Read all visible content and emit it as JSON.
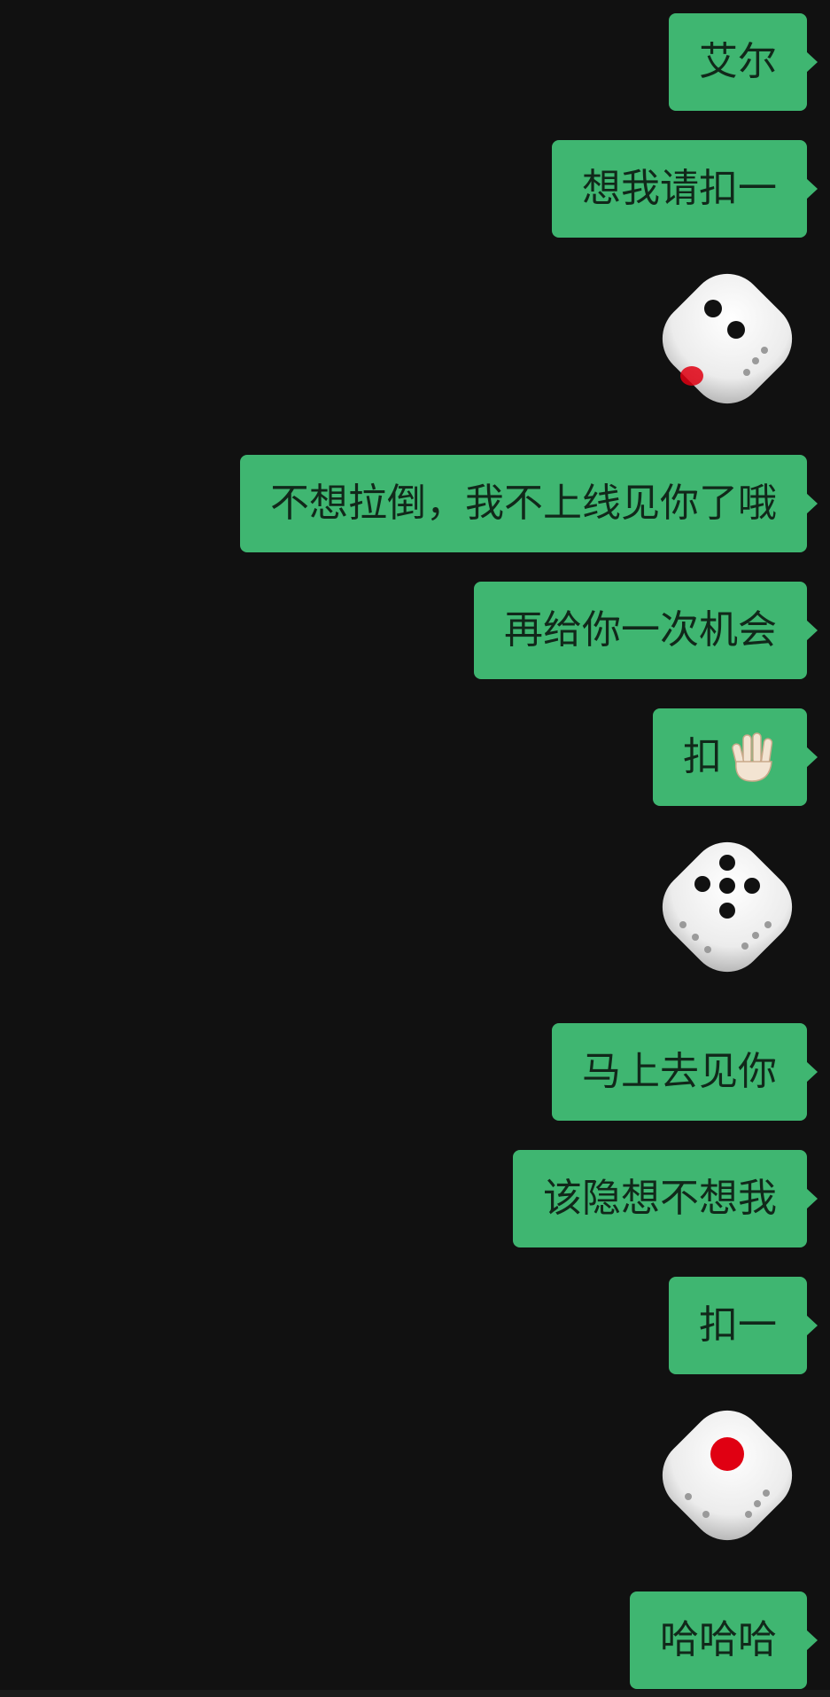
{
  "theme": {
    "background": "#111111",
    "bubble_color": "#3fb671",
    "text_color": "#11281a",
    "pip_black": "#111111",
    "pip_red": "#e00012"
  },
  "messages": [
    {
      "type": "text",
      "text": "艾尔"
    },
    {
      "type": "text",
      "text": "想我请扣一"
    },
    {
      "type": "dice",
      "face": 3,
      "icon": "dice-icon"
    },
    {
      "type": "text",
      "text": "不想拉倒，我不上线见你了哦"
    },
    {
      "type": "text",
      "text": "再给你一次机会"
    },
    {
      "type": "text",
      "text": "扣",
      "emoji": "raised-hand-icon"
    },
    {
      "type": "dice",
      "face": 5,
      "icon": "dice-icon"
    },
    {
      "type": "text",
      "text": "马上去见你"
    },
    {
      "type": "text",
      "text": "该隐想不想我"
    },
    {
      "type": "text",
      "text": "扣一"
    },
    {
      "type": "dice",
      "face": 1,
      "icon": "dice-icon"
    },
    {
      "type": "text",
      "text": "哈哈哈"
    }
  ]
}
